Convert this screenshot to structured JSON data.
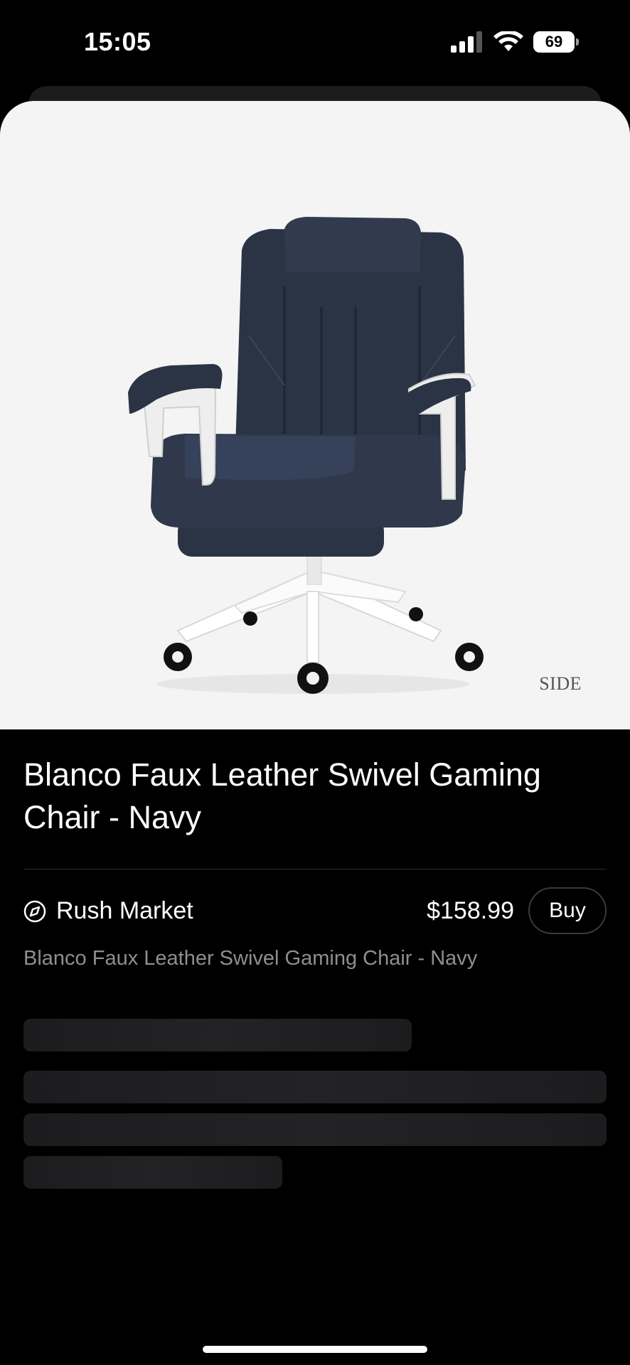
{
  "status_bar": {
    "time": "15:05",
    "battery": "69",
    "icons": [
      "cellular-signal-icon",
      "wifi-icon",
      "battery-icon"
    ]
  },
  "product": {
    "image_label": "SIDE",
    "image_subject": "navy faux leather swivel gaming chair with white base",
    "title": "Blanco Faux Leather Swivel Gaming Chair - Navy",
    "merchant": "Rush Market",
    "merchant_icon": "compass-icon",
    "price": "$158.99",
    "buy_label": "Buy",
    "subtitle": "Blanco Faux Leather Swivel Gaming Chair - Navy"
  },
  "loading_placeholders": 4,
  "colors": {
    "background": "#000000",
    "image_background": "#f4f4f4",
    "chair": "#2b3445",
    "subtitle": "#8e8e93",
    "skeleton": "#1c1c1e"
  }
}
